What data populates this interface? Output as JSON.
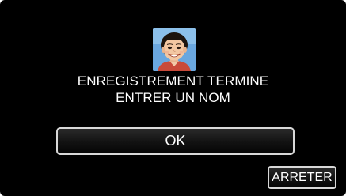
{
  "dialog": {
    "message_line1": "ENREGISTREMENT TERMINE",
    "message_line2": "ENTRER UN NOM",
    "ok_label": "OK",
    "stop_label": "ARRETER"
  },
  "colors": {
    "background": "#000000",
    "text": "#ffffff",
    "button_border": "#d8d8d8",
    "avatar_backdrop": "#6aa7df"
  }
}
